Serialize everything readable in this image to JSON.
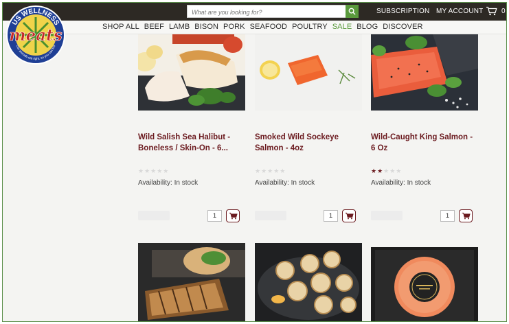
{
  "logo": {
    "top_text": "US WELLNESS",
    "script_text": "meats",
    "ring_text": "Our animals eat right, so you can too"
  },
  "search": {
    "placeholder": "What are you looking for?",
    "icon": "search-icon"
  },
  "topnav": {
    "subscription": "SUBSCRIPTION",
    "account": "MY ACCOUNT",
    "cart_count": "0"
  },
  "categories": [
    "SHOP ALL",
    "BEEF",
    "LAMB",
    "BISON",
    "PORK",
    "SEAFOOD",
    "POULTRY",
    "SALE",
    "BLOG",
    "DISCOVER"
  ],
  "products": [
    {
      "name_line1": "Wild Salish Sea Halibut -",
      "name_line2": "Boneless / Skin-On - 6...",
      "rating": 0,
      "availability": "Availability: In stock",
      "qty": "1"
    },
    {
      "name_line1": "Smoked Wild Sockeye",
      "name_line2": "Salmon - 4oz",
      "rating": 0,
      "availability": "Availability: In stock",
      "qty": "1"
    },
    {
      "name_line1": "Wild-Caught King Salmon -",
      "name_line2": "6 Oz",
      "rating": 2,
      "availability": "Availability: In stock",
      "qty": "1"
    }
  ],
  "colors": {
    "topbar": "#2d2924",
    "accent_green": "#5a9a3c",
    "product_name": "#6b1a1f",
    "frame_border": "#5b8f4a"
  }
}
